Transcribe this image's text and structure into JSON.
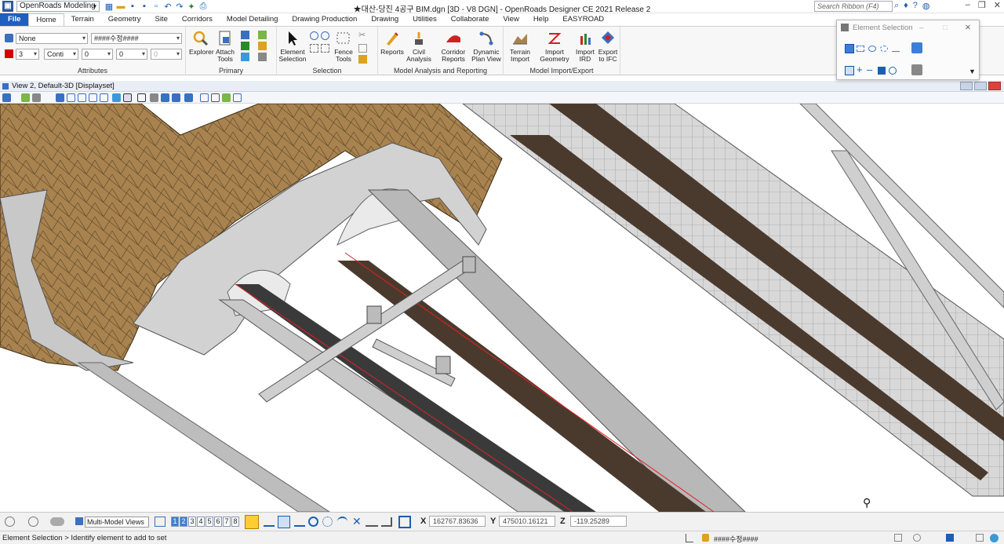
{
  "app": {
    "workspace": "OpenRoads Modeling",
    "window_title": "★대산-당진 4공구 BIM.dgn [3D - V8 DGN] - OpenRoads Designer CE 2021 Release 2",
    "search_placeholder": "Search Ribbon (F4)"
  },
  "tabs": [
    "File",
    "Home",
    "Terrain",
    "Geometry",
    "Site",
    "Corridors",
    "Model Detailing",
    "Drawing Production",
    "Drawing",
    "Utilities",
    "Collaborate",
    "View",
    "Help",
    "EASYROAD"
  ],
  "active_tab": "Home",
  "ribbon": {
    "attributes": {
      "label": "Attributes",
      "level": "None",
      "template": "####수정####",
      "color": "3",
      "linestyle": "Conti",
      "weight": "0",
      "transparency": "0",
      "priority": "0"
    },
    "primary": {
      "label": "Primary",
      "explorer": "Explorer",
      "attach_tools": [
        "Attach",
        "Tools"
      ]
    },
    "selection": {
      "label": "Selection",
      "element_selection": [
        "Element",
        "Selection"
      ],
      "fence_tools": [
        "Fence",
        "Tools"
      ]
    },
    "analysis": {
      "label": "Model Analysis and Reporting",
      "reports": "Reports",
      "civil_analysis": [
        "Civil",
        "Analysis"
      ],
      "corridor_reports": [
        "Corridor",
        "Reports"
      ],
      "dynamic_plan_view": [
        "Dynamic",
        "Plan View"
      ]
    },
    "import_export": {
      "label": "Model Import/Export",
      "terrain_import": [
        "Terrain",
        "Import"
      ],
      "import_geometry": [
        "Import",
        "Geometry"
      ],
      "import_ird": [
        "Import",
        "IRD"
      ],
      "export_ifc": [
        "Export",
        "to IFC"
      ]
    }
  },
  "element_selection_panel": {
    "title": "Element Selection"
  },
  "view": {
    "title": "View 2, Default-3D [Displayset]"
  },
  "bottom": {
    "multi_model_views": "Multi-Model Views",
    "view_numbers": [
      "1",
      "2",
      "3",
      "4",
      "5",
      "6",
      "7",
      "8"
    ],
    "x_label": "X",
    "x_value": "162767.83636",
    "y_label": "Y",
    "y_value": "475010.16121",
    "z_label": "Z",
    "z_value": "-119.25289"
  },
  "status": {
    "prompt": "Element Selection > Identify element to add to set",
    "active_template": "####수정####"
  },
  "colors": {
    "file_tab": "#1f5fbf",
    "terrain": "#a8834f",
    "structure": "#d6d6d6",
    "beam": "#4a3a2e",
    "redline": "#e52020",
    "active_color_swatch": "#d40000"
  }
}
